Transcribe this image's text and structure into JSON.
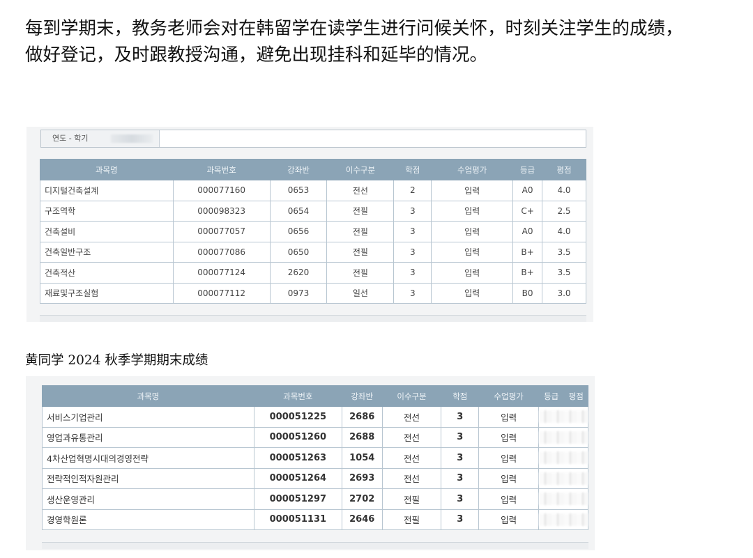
{
  "intro": {
    "line1": "每到学期末，教务老师会对在韩留学在读学生进行问候关怀，时刻关注学生的成绩，",
    "line2": "做好登记，及时跟教授沟通，避免出现挂科和延毕的情况。"
  },
  "table1": {
    "year_semester_label": "연도 - 학기",
    "headers": [
      "과목명",
      "과목번호",
      "강좌반",
      "이수구분",
      "학점",
      "수업평가",
      "등급",
      "평점"
    ],
    "rows": [
      [
        "디지털건축설계",
        "000077160",
        "0653",
        "전선",
        "2",
        "입력",
        "A0",
        "4.0"
      ],
      [
        "구조역학",
        "000098323",
        "0654",
        "전필",
        "3",
        "입력",
        "C+",
        "2.5"
      ],
      [
        "건축설비",
        "000077057",
        "0656",
        "전필",
        "3",
        "입력",
        "A0",
        "4.0"
      ],
      [
        "건축일반구조",
        "000077086",
        "0650",
        "전필",
        "3",
        "입력",
        "B+",
        "3.5"
      ],
      [
        "건축적산",
        "000077124",
        "2620",
        "전필",
        "3",
        "입력",
        "B+",
        "3.5"
      ],
      [
        "재료및구조실험",
        "000077112",
        "0973",
        "일선",
        "3",
        "입력",
        "B0",
        "3.0"
      ]
    ]
  },
  "caption": "黄同学 2024 秋季学期期末成绩",
  "table2": {
    "headers": [
      "과목명",
      "과목번호",
      "강좌반",
      "이수구분",
      "학점",
      "수업평가",
      "등급",
      "평점"
    ],
    "rows": [
      [
        "서비스기업관리",
        "000051225",
        "2686",
        "전선",
        "3",
        "입력"
      ],
      [
        "영업과유통관리",
        "000051260",
        "2688",
        "전선",
        "3",
        "입력"
      ],
      [
        "4차산업혁명시대의경영전략",
        "000051263",
        "1054",
        "전선",
        "3",
        "입력"
      ],
      [
        "전략적인적자원관리",
        "000051264",
        "2693",
        "전선",
        "3",
        "입력"
      ],
      [
        "생산운영관리",
        "000051297",
        "2702",
        "전필",
        "3",
        "입력"
      ],
      [
        "경영학원론",
        "000051131",
        "2646",
        "전필",
        "3",
        "입력"
      ]
    ]
  }
}
